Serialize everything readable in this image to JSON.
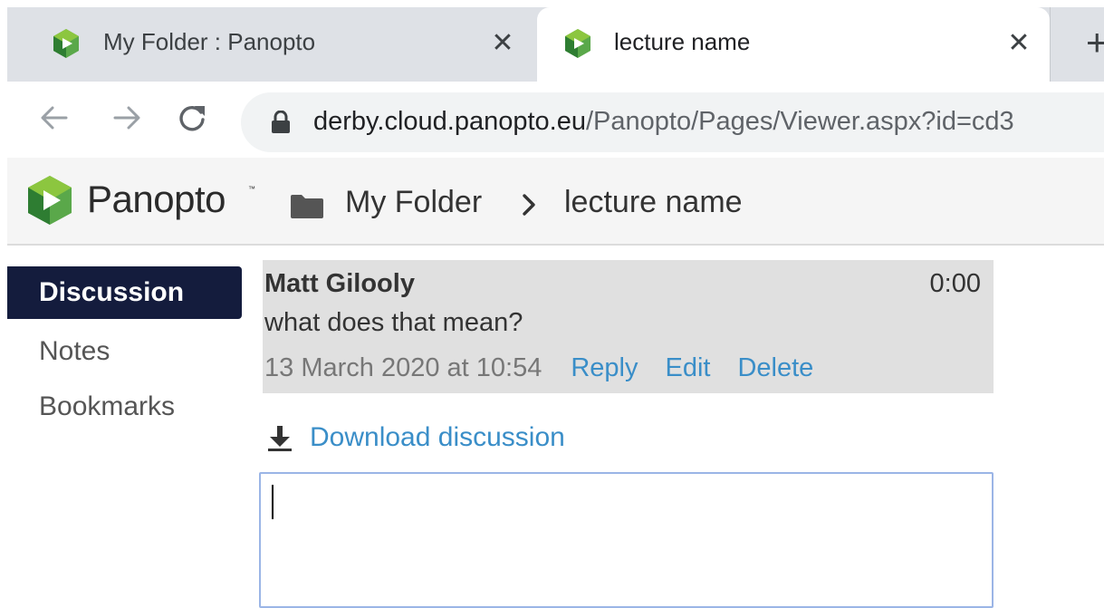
{
  "browser": {
    "tabs": [
      {
        "title": "My Folder : Panopto",
        "active": false,
        "favicon": "panopto-logo-icon"
      },
      {
        "title": "lecture name",
        "active": true,
        "favicon": "panopto-logo-icon"
      }
    ],
    "new_tab_icon": "plus-icon",
    "nav_icons": [
      "back-arrow-icon",
      "forward-arrow-icon",
      "reload-icon"
    ],
    "url": {
      "host": "derby.cloud.panopto.eu",
      "path": "/Panopto/Pages/Viewer.aspx?id=cd3"
    }
  },
  "app": {
    "logo_text": "Panopto",
    "logo_tm": "™",
    "breadcrumb": {
      "folder": "My Folder",
      "current": "lecture name"
    }
  },
  "sidebar": {
    "tabs": [
      {
        "label": "Discussion",
        "active": true
      },
      {
        "label": "Notes",
        "active": false
      },
      {
        "label": "Bookmarks",
        "active": false
      }
    ]
  },
  "discussion": {
    "comments": [
      {
        "author": "Matt Gilooly",
        "time": "0:00",
        "body": "what does that mean?",
        "date": "13 March 2020 at 10:54",
        "actions": {
          "reply": "Reply",
          "edit": "Edit",
          "delete": "Delete"
        }
      }
    ],
    "download_label": "Download discussion",
    "input_value": ""
  },
  "colors": {
    "chrome_bg": "#dee1e6",
    "panopto_nav": "#141c3d",
    "link": "#3a8ec8",
    "logo_green": "#5aa84a"
  }
}
